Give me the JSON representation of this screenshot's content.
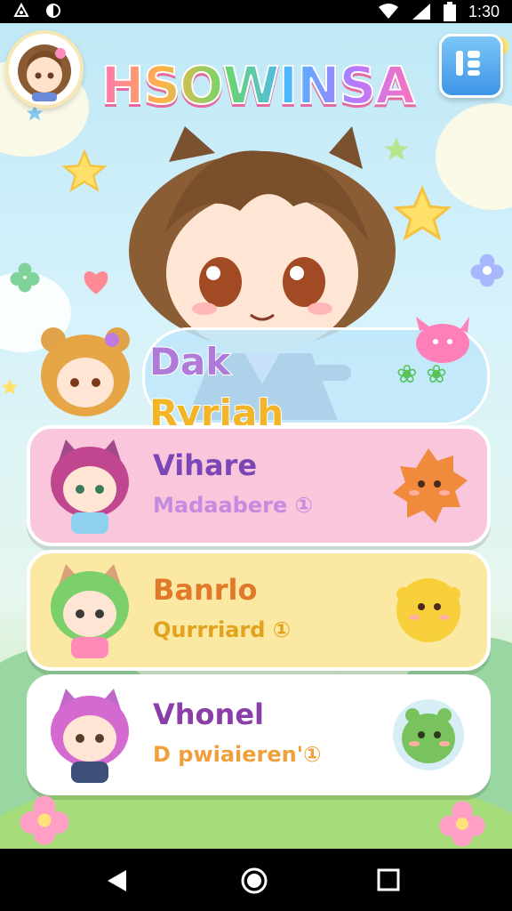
{
  "status": {
    "time": "1:30"
  },
  "header": {
    "title": "HSOWINSA"
  },
  "hero": {
    "name_line1": "Dak",
    "name_line2": "Ryriah",
    "badge": "❀ ❀"
  },
  "cards": [
    {
      "name": "Vihare",
      "sub": "Madaabere ①",
      "bg": "#f9c6dc",
      "name_color": "#7b46b5",
      "sub_color": "#c48be0"
    },
    {
      "name": "Banrlo",
      "sub": "Qurrriard ①",
      "bg": "#fbe9a3",
      "name_color": "#e07a2a",
      "sub_color": "#e2a21c"
    },
    {
      "name": "Vhonel",
      "sub": "D pwiaieren'①",
      "bg": "#ffffff",
      "name_color": "#8a3fa8",
      "sub_color": "#f0a03a"
    }
  ],
  "icons": {
    "menu": "menu-grid-icon",
    "back": "back-triangle-icon",
    "home": "home-circle-icon",
    "recents": "recents-square-icon"
  }
}
